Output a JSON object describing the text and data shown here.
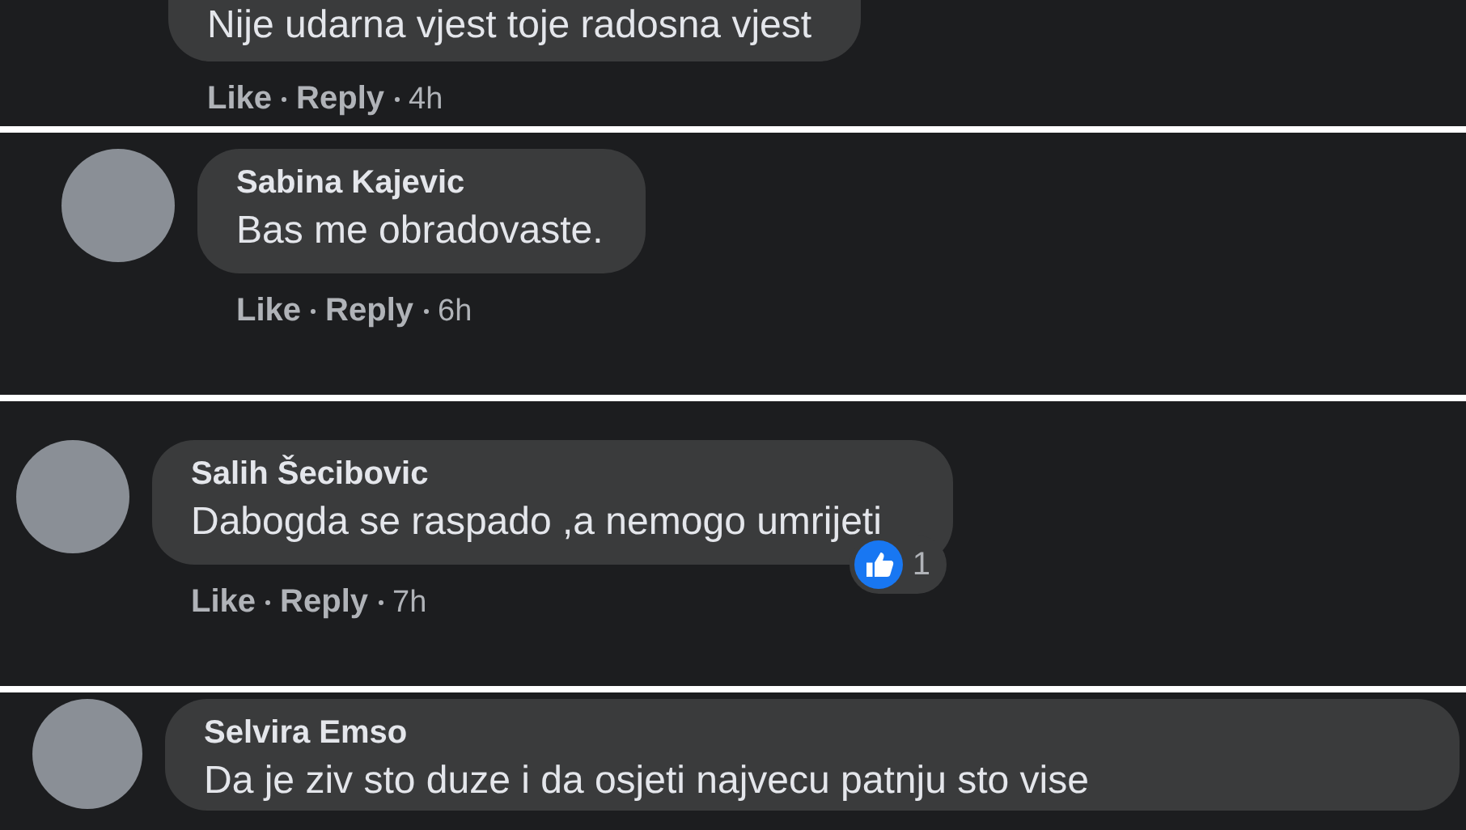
{
  "comments": [
    {
      "text": "Nije udarna vjest toje radosna vjest",
      "like": "Like",
      "reply": "Reply",
      "time": "4h"
    },
    {
      "name": "Sabina Kajevic",
      "text": "Bas me obradovaste.",
      "like": "Like",
      "reply": "Reply",
      "time": "6h"
    },
    {
      "name": "Salih Šecibovic",
      "text": "Dabogda se raspado ,a nemogo umrijeti",
      "like": "Like",
      "reply": "Reply",
      "time": "7h",
      "reaction_count": "1"
    },
    {
      "name": "Selvira Emso",
      "text": "Da je ziv sto duze i da osjeti najvecu patnju sto vise"
    }
  ]
}
